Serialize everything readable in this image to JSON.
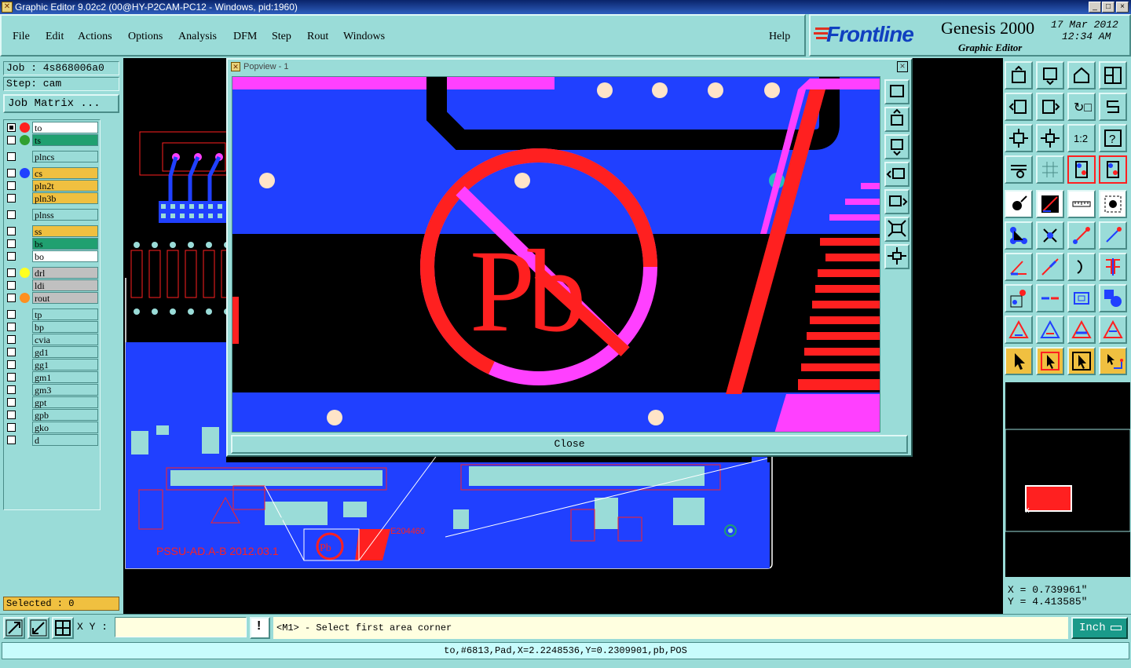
{
  "window": {
    "title": "Graphic Editor 9.02c2 (00@HY-P2CAM-PC12 - Windows, pid:1960)",
    "minimize": "_",
    "maximize": "□",
    "close": "×"
  },
  "menu": [
    "File",
    "Edit",
    "Actions",
    "Options",
    "Analysis",
    "DFM",
    "Step",
    "Rout",
    "Windows"
  ],
  "help": "Help",
  "brand": {
    "logo": "Frontline",
    "product": "Genesis 2000",
    "subtitle": "Graphic Editor",
    "date": "17 Mar 2012",
    "time": "12:34 AM"
  },
  "job": {
    "job_label": "Job : 4s868006a0",
    "step_label": "Step: cam",
    "matrix_button": "Job Matrix ..."
  },
  "layers": [
    {
      "name": "to",
      "bg": "#ffffff",
      "dot": "#ff2020",
      "group": 1
    },
    {
      "name": "ts",
      "bg": "#20a070",
      "dot": "#30a030",
      "group": 1
    },
    {
      "name": "plncs",
      "bg": "#9adcd8",
      "dot": "",
      "group": 2
    },
    {
      "name": "cs",
      "bg": "#f0c040",
      "dot": "#2040ff",
      "group": 3
    },
    {
      "name": "pln2t",
      "bg": "#f0c040",
      "dot": "",
      "group": 3
    },
    {
      "name": "pln3b",
      "bg": "#f0c040",
      "dot": "",
      "group": 3
    },
    {
      "name": "plnss",
      "bg": "#9adcd8",
      "dot": "",
      "group": 4
    },
    {
      "name": "ss",
      "bg": "#f0c040",
      "dot": "",
      "group": 5
    },
    {
      "name": "bs",
      "bg": "#20a070",
      "dot": "",
      "group": 5
    },
    {
      "name": "bo",
      "bg": "#ffffff",
      "dot": "",
      "group": 5
    },
    {
      "name": "drl",
      "bg": "#c0c0c0",
      "dot": "#ffff20",
      "group": 6
    },
    {
      "name": "ldi",
      "bg": "#c0c0c0",
      "dot": "",
      "group": 6
    },
    {
      "name": "rout",
      "bg": "#c0c0c0",
      "dot": "#ff9020",
      "group": 6
    },
    {
      "name": "tp",
      "bg": "#9adcd8",
      "dot": "",
      "group": 7
    },
    {
      "name": "bp",
      "bg": "#9adcd8",
      "dot": "",
      "group": 7
    },
    {
      "name": "cvia",
      "bg": "#9adcd8",
      "dot": "",
      "group": 7
    },
    {
      "name": "gd1",
      "bg": "#9adcd8",
      "dot": "",
      "group": 7
    },
    {
      "name": "gg1",
      "bg": "#9adcd8",
      "dot": "",
      "group": 7
    },
    {
      "name": "gm1",
      "bg": "#9adcd8",
      "dot": "",
      "group": 7
    },
    {
      "name": "gm3",
      "bg": "#9adcd8",
      "dot": "",
      "group": 7
    },
    {
      "name": "gpt",
      "bg": "#9adcd8",
      "dot": "",
      "group": 7
    },
    {
      "name": "gpb",
      "bg": "#9adcd8",
      "dot": "",
      "group": 7
    },
    {
      "name": "gko",
      "bg": "#9adcd8",
      "dot": "",
      "group": 7
    },
    {
      "name": "d",
      "bg": "#9adcd8",
      "dot": "",
      "group": 7
    }
  ],
  "selected": "Selected : 0",
  "popview": {
    "title": "Popview - 1",
    "close_label": "Close",
    "close_x": "×"
  },
  "board_text": {
    "silk": "PSSU-AD.A-B 2012.03.1",
    "code": "E204460",
    "pb": "Pb"
  },
  "coords": {
    "x": "X = 0.739961\"",
    "y": "Y = 4.413585\""
  },
  "bottom": {
    "xy_label": "X Y :",
    "xy_value": "",
    "prompt_marker": "!",
    "prompt": "<M1> - Select first area corner",
    "unit": "Inch"
  },
  "status": "to,#6813,Pad,X=2.2248536,Y=0.2309901,pb,POS"
}
